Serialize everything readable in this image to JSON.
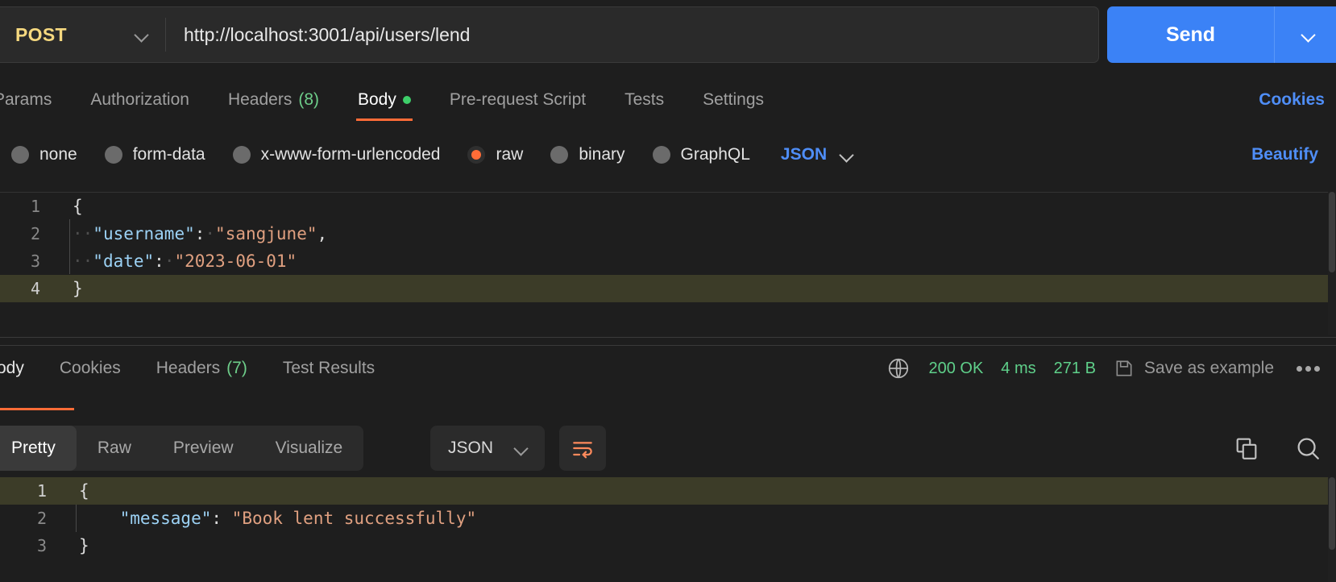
{
  "request": {
    "method": "POST",
    "url": "http://localhost:3001/api/users/lend",
    "send_label": "Send",
    "tabs": [
      {
        "label": "Params",
        "count": "",
        "dot": false,
        "active": false
      },
      {
        "label": "Authorization",
        "count": "",
        "dot": false,
        "active": false
      },
      {
        "label": "Headers",
        "count": "(8)",
        "dot": false,
        "active": false
      },
      {
        "label": "Body",
        "count": "",
        "dot": true,
        "active": true
      },
      {
        "label": "Pre-request Script",
        "count": "",
        "dot": false,
        "active": false
      },
      {
        "label": "Tests",
        "count": "",
        "dot": false,
        "active": false
      },
      {
        "label": "Settings",
        "count": "",
        "dot": false,
        "active": false
      }
    ],
    "cookies_label": "Cookies",
    "body_types": [
      {
        "label": "none",
        "selected": false
      },
      {
        "label": "form-data",
        "selected": false
      },
      {
        "label": "x-www-form-urlencoded",
        "selected": false
      },
      {
        "label": "raw",
        "selected": true
      },
      {
        "label": "binary",
        "selected": false
      },
      {
        "label": "GraphQL",
        "selected": false
      }
    ],
    "format_selected": "JSON",
    "beautify_label": "Beautify",
    "body_lines": [
      {
        "num": "1",
        "active": false,
        "segments": [
          {
            "t": "{",
            "c": "p"
          }
        ]
      },
      {
        "num": "2",
        "active": false,
        "segments": [
          {
            "t": "··",
            "c": "dot"
          },
          {
            "t": "\"username\"",
            "c": "k"
          },
          {
            "t": ":",
            "c": "p"
          },
          {
            "t": "·",
            "c": "dot"
          },
          {
            "t": "\"sangjune\"",
            "c": "v"
          },
          {
            "t": ",",
            "c": "p"
          }
        ]
      },
      {
        "num": "3",
        "active": false,
        "segments": [
          {
            "t": "··",
            "c": "dot"
          },
          {
            "t": "\"date\"",
            "c": "k"
          },
          {
            "t": ":",
            "c": "p"
          },
          {
            "t": "·",
            "c": "dot"
          },
          {
            "t": "\"2023-06-01\"",
            "c": "v"
          }
        ]
      },
      {
        "num": "4",
        "active": true,
        "segments": [
          {
            "t": "}",
            "c": "p"
          }
        ]
      }
    ]
  },
  "response": {
    "tabs": [
      {
        "label": "Body",
        "count": "",
        "active": true
      },
      {
        "label": "Cookies",
        "count": "",
        "active": false
      },
      {
        "label": "Headers",
        "count": "(7)",
        "active": false
      },
      {
        "label": "Test Results",
        "count": "",
        "active": false
      }
    ],
    "status": "200 OK",
    "time": "4 ms",
    "size": "271 B",
    "save_example_label": "Save as example",
    "viewer_tabs": [
      {
        "label": "Pretty",
        "active": true
      },
      {
        "label": "Raw",
        "active": false
      },
      {
        "label": "Preview",
        "active": false
      },
      {
        "label": "Visualize",
        "active": false
      }
    ],
    "format_selected": "JSON",
    "body_lines": [
      {
        "num": "1",
        "active": true,
        "segments": [
          {
            "t": "{",
            "c": "p"
          }
        ]
      },
      {
        "num": "2",
        "active": false,
        "segments": [
          {
            "t": "    ",
            "c": "p"
          },
          {
            "t": "\"message\"",
            "c": "k"
          },
          {
            "t": ": ",
            "c": "p"
          },
          {
            "t": "\"Book lent successfully\"",
            "c": "v"
          }
        ]
      },
      {
        "num": "3",
        "active": false,
        "segments": [
          {
            "t": "}",
            "c": "p"
          }
        ]
      }
    ]
  },
  "colors": {
    "accent_orange": "#ff6c37",
    "send_blue": "#3b82f6",
    "link_blue": "#4f8ef7",
    "status_green": "#5fd08a",
    "method_yellow": "#f5d87f"
  }
}
